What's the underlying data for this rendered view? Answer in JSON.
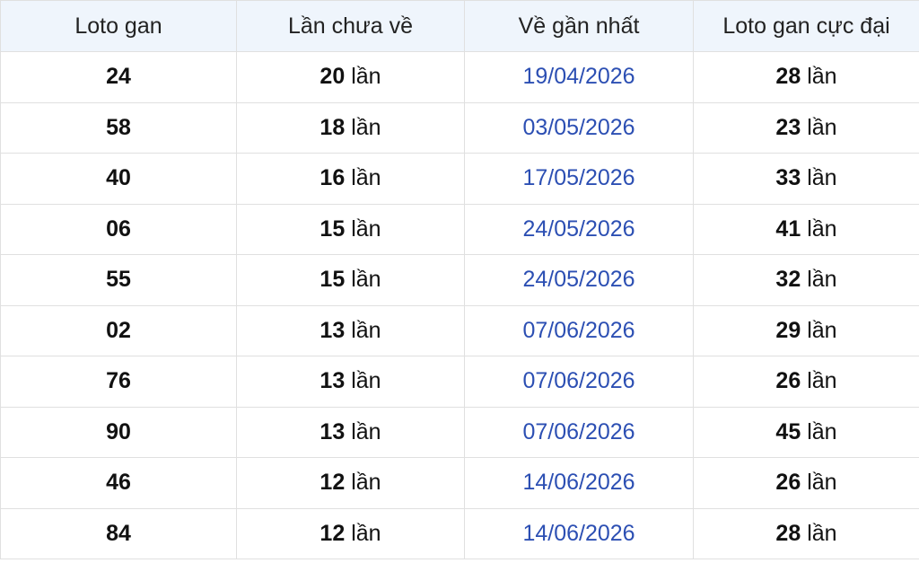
{
  "table": {
    "headers": [
      "Loto gan",
      "Lần chưa về",
      "Về gần nhất",
      "Loto gan cực đại"
    ],
    "unit": "lần",
    "rows": [
      {
        "loto": "24",
        "absent": "20",
        "last_seen": "19/04/2026",
        "max_gan": "28"
      },
      {
        "loto": "58",
        "absent": "18",
        "last_seen": "03/05/2026",
        "max_gan": "23"
      },
      {
        "loto": "40",
        "absent": "16",
        "last_seen": "17/05/2026",
        "max_gan": "33"
      },
      {
        "loto": "06",
        "absent": "15",
        "last_seen": "24/05/2026",
        "max_gan": "41"
      },
      {
        "loto": "55",
        "absent": "15",
        "last_seen": "24/05/2026",
        "max_gan": "32"
      },
      {
        "loto": "02",
        "absent": "13",
        "last_seen": "07/06/2026",
        "max_gan": "29"
      },
      {
        "loto": "76",
        "absent": "13",
        "last_seen": "07/06/2026",
        "max_gan": "26"
      },
      {
        "loto": "90",
        "absent": "13",
        "last_seen": "07/06/2026",
        "max_gan": "45"
      },
      {
        "loto": "46",
        "absent": "12",
        "last_seen": "14/06/2026",
        "max_gan": "26"
      },
      {
        "loto": "84",
        "absent": "12",
        "last_seen": "14/06/2026",
        "max_gan": "28"
      }
    ]
  },
  "colors": {
    "header_bg": "#eff5fc",
    "date_text": "#2c4fb3",
    "border": "#e0e0e0"
  }
}
